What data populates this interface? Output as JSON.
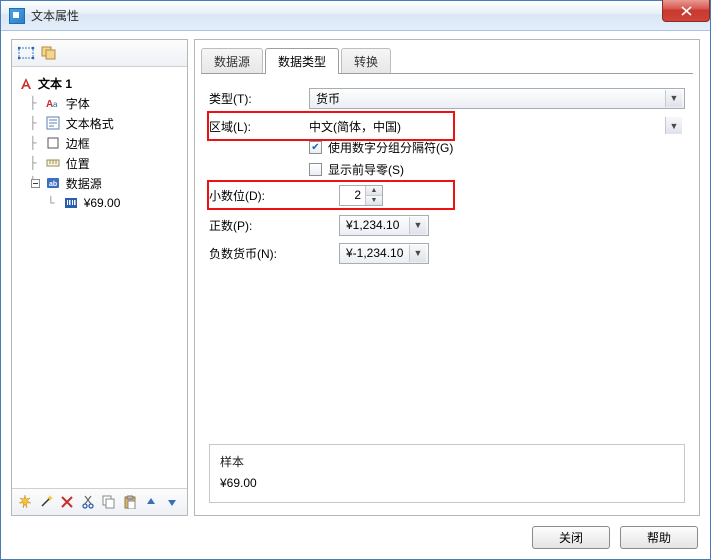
{
  "window": {
    "title": "文本属性"
  },
  "tree": {
    "root": "文本 1",
    "items": [
      "字体",
      "文本格式",
      "边框",
      "位置",
      "数据源"
    ],
    "datasource_child": "¥69.00"
  },
  "tabs": {
    "t0": "数据源",
    "t1": "数据类型",
    "t2": "转换"
  },
  "form": {
    "type_label": "类型(T):",
    "type_value": "货币",
    "region_label": "区域(L):",
    "region_value": "中文(简体，中国)",
    "use_group_sep": "使用数字分组分隔符(G)",
    "leading_zero": "显示前导零(S)",
    "decimals_label": "小数位(D):",
    "decimals_value": "2",
    "positive_label": "正数(P):",
    "positive_value": "¥1,234.10",
    "negative_label": "负数货币(N):",
    "negative_value": "¥-1,234.10"
  },
  "sample": {
    "title": "样本",
    "value": "¥69.00"
  },
  "footer": {
    "close": "关闭",
    "help": "帮助"
  }
}
